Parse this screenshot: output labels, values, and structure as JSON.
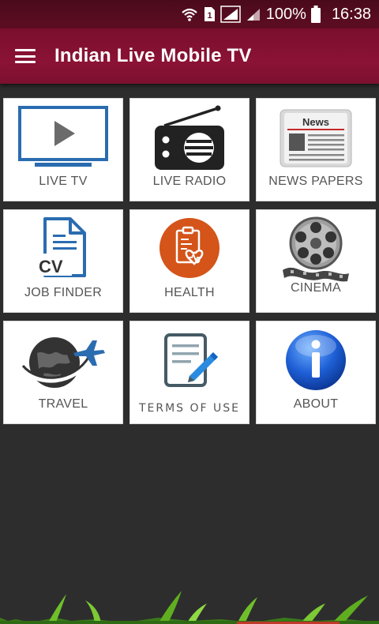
{
  "status_bar": {
    "battery": "100%",
    "time": "16:38",
    "sim_number": "1"
  },
  "app_bar": {
    "title": "Indian Live Mobile TV",
    "menu_icon": "hamburger-menu-icon"
  },
  "tiles": [
    {
      "label": "LIVE TV",
      "icon": "tv-play-icon"
    },
    {
      "label": "LIVE RADIO",
      "icon": "radio-icon"
    },
    {
      "label": "NEWS PAPERS",
      "icon": "newspaper-icon",
      "icon_text": "News"
    },
    {
      "label": "JOB FINDER",
      "icon": "cv-document-icon",
      "icon_text": "CV"
    },
    {
      "label": "HEALTH",
      "icon": "health-clipboard-icon"
    },
    {
      "label": "CINEMA",
      "icon": "film-reel-icon"
    },
    {
      "label": "TRAVEL",
      "icon": "globe-airplane-icon"
    },
    {
      "label": "TERMS OF USE",
      "icon": "document-pencil-icon"
    },
    {
      "label": "ABOUT",
      "icon": "info-icon"
    }
  ],
  "colors": {
    "app_bar": "#8b1234",
    "background": "#2d2d2d",
    "tile": "#ffffff",
    "accent_blue": "#2a6cb0",
    "health_orange": "#d4541a"
  }
}
